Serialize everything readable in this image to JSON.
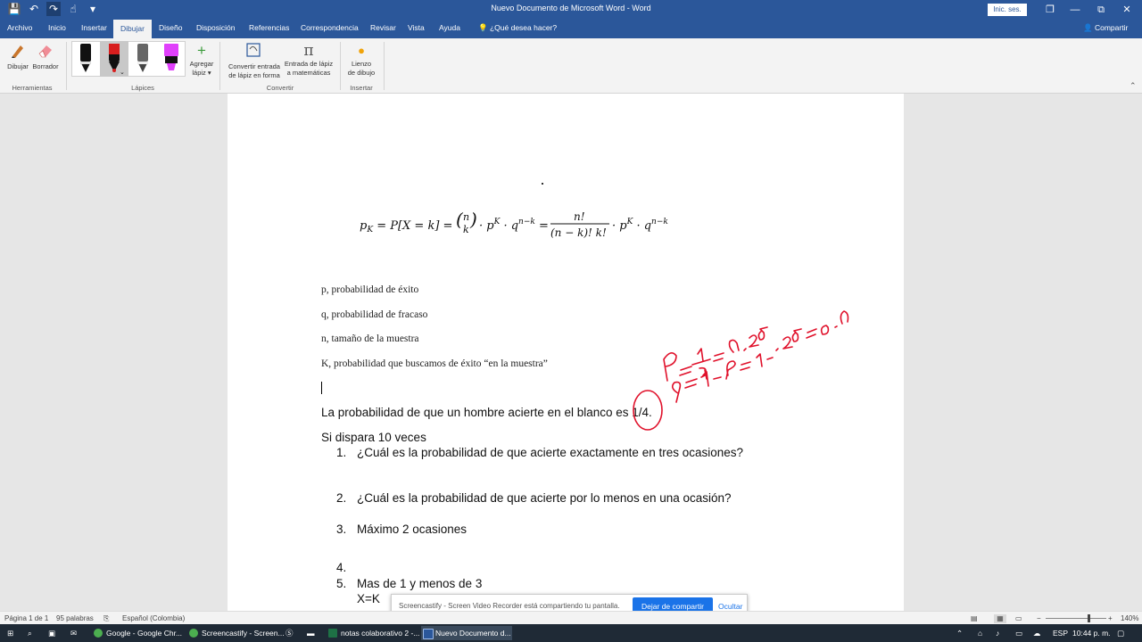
{
  "window": {
    "title": "Nuevo Documento de Microsoft Word  -  Word",
    "sign_in": "Inic. ses.",
    "minimize": "—",
    "restore": "❐",
    "maximize": "⧉",
    "close": "✕"
  },
  "quick_access": {
    "save_icon": "💾",
    "undo_icon": "↶",
    "redo_icon": "↷",
    "touch_icon": "☝",
    "customize_icon": "▾"
  },
  "tabs": [
    "Archivo",
    "Inicio",
    "Insertar",
    "Dibujar",
    "Diseño",
    "Disposición",
    "Referencias",
    "Correspondencia",
    "Revisar",
    "Vista",
    "Ayuda"
  ],
  "active_tab": "Dibujar",
  "tell_me": "¿Qué desea hacer?",
  "share": "Compartir",
  "ribbon": {
    "draw_label": "Dibujar",
    "eraser_label": "Borrador",
    "group_tools": "Herramientas",
    "group_pens": "Lápices",
    "add_pen_label_1": "Agregar",
    "add_pen_label_2": "lápiz ▾",
    "convert_shape_1": "Convertir entrada",
    "convert_shape_2": "de lápiz en forma",
    "convert_math_1": "Entrada de lápiz",
    "convert_math_2": "a matemáticas",
    "group_convert": "Convertir",
    "canvas_1": "Lienzo",
    "canvas_2": "de dibujo",
    "group_insert": "Insertar",
    "pen_colors": [
      "#111111",
      "#d81e1e",
      "#666666",
      "#e040fb"
    ]
  },
  "document": {
    "formula": "p_K = P[X = k] = (n k) · p^K · q^(n−k) = n! / (n − k)! k! · p^K · q^(n−k)",
    "lines": [
      "p, probabilidad de éxito",
      "q, probabilidad de fracaso",
      "n, tamaño de la muestra",
      "K, probabilidad que buscamos de éxito “en la muestra”"
    ],
    "sentence": "La probabilidad de que un hombre acierte en el blanco es 1/4.",
    "sentence_2": "Si dispara 10 veces",
    "list": [
      {
        "num": "1.",
        "text": "¿Cuál es la probabilidad de que acierte exactamente en tres ocasiones?"
      },
      {
        "num": "2.",
        "text": "¿Cuál es la probabilidad de que acierte por lo menos en una ocasión?"
      },
      {
        "num": "3.",
        "text": "Máximo 2 ocasiones"
      },
      {
        "num": "4.",
        "text": ""
      },
      {
        "num": "5.",
        "text": "Mas de 1 y menos de 3"
      }
    ],
    "extra": "X=K",
    "ink_color": "#e0102a"
  },
  "banner": {
    "message": "Screencastify - Screen Video Recorder está compartiendo tu pantalla.",
    "stop_button": "Dejar de compartir",
    "hide_button": "Ocultar"
  },
  "status": {
    "page": "Página 1 de 1",
    "words": "95 palabras",
    "language": "Español (Colombia)",
    "zoom": "140%",
    "zoom_fraction": 0.7
  },
  "taskbar": {
    "items": [
      "Google - Google Chr...",
      "Screencastify - Screen...",
      "notas colaborativo 2 -...",
      "Nuevo Documento d..."
    ],
    "lang": "ESP",
    "time": "10:44 p. m."
  }
}
